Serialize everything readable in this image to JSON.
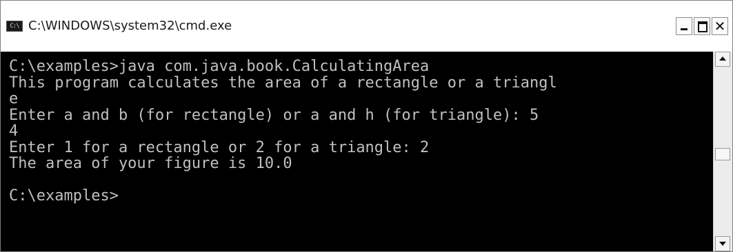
{
  "window": {
    "title": "C:\\WINDOWS\\system32\\cmd.exe",
    "icon_text": "C:\\",
    "close_symbol": "✕"
  },
  "console": {
    "lines": [
      "C:\\examples>java com.java.book.CalculatingArea",
      "This program calculates the area of a rectangle or a triangl",
      "e",
      "Enter a and b (for rectangle) or a and h (for triangle): 5",
      "4",
      "Enter 1 for a rectangle or 2 for a triangle: 2",
      "The area of your figure is 10.0",
      "",
      "C:\\examples>"
    ],
    "colors": {
      "background": "#000000",
      "foreground": "#c0c0c0"
    }
  },
  "scrollbar": {
    "position": 0.5
  }
}
